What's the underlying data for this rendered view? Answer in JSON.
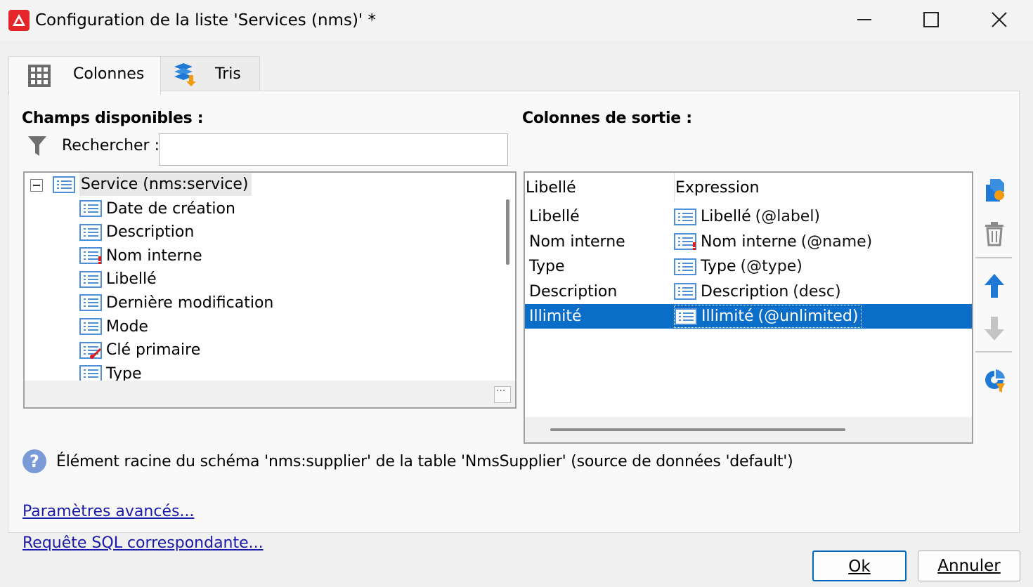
{
  "window": {
    "title": "Configuration de la liste 'Services (nms)' *"
  },
  "tabs": [
    {
      "label": "Colonnes",
      "icon": "grid-icon",
      "active": true
    },
    {
      "label": "Tris",
      "icon": "sort-icon",
      "active": false
    }
  ],
  "left_panel": {
    "title": "Champs disponibles :",
    "search_label": "Rechercher :",
    "search_value": "",
    "tree": {
      "root": "Service (nms:service)",
      "children": [
        {
          "label": "Date de création",
          "icon": "field-icon"
        },
        {
          "label": "Description",
          "icon": "field-icon"
        },
        {
          "label": "Nom interne",
          "icon": "field-required-icon"
        },
        {
          "label": "Libellé",
          "icon": "field-icon"
        },
        {
          "label": "Dernière modification",
          "icon": "field-icon"
        },
        {
          "label": "Mode",
          "icon": "field-icon"
        },
        {
          "label": "Clé primaire",
          "icon": "field-key-icon"
        },
        {
          "label": "Type",
          "icon": "field-icon"
        }
      ]
    }
  },
  "right_panel": {
    "title": "Colonnes de sortie :",
    "headers": {
      "label": "Libellé",
      "expression": "Expression"
    },
    "rows": [
      {
        "label": "Libellé",
        "expr_name": "Libellé",
        "expr_path": "(@label)",
        "icon": "field-icon",
        "selected": false
      },
      {
        "label": "Nom interne",
        "expr_name": "Nom interne",
        "expr_path": "(@name)",
        "icon": "field-required-icon",
        "selected": false
      },
      {
        "label": "Type",
        "expr_name": "Type",
        "expr_path": "(@type)",
        "icon": "field-icon",
        "selected": false
      },
      {
        "label": "Description",
        "expr_name": "Description",
        "expr_path": "(desc)",
        "icon": "field-icon",
        "selected": false
      },
      {
        "label": "Illimité",
        "expr_name": "Illimité",
        "expr_path": "(@unlimited)",
        "icon": "field-icon",
        "selected": true
      }
    ]
  },
  "side_tools": [
    "add-column-icon",
    "delete-icon",
    "move-up-icon",
    "move-down-icon",
    "distribution-icon"
  ],
  "info": {
    "text": "Élément racine du schéma 'nms:supplier' de la table 'NmsSupplier' (source de données 'default')"
  },
  "links": {
    "advanced": "Paramètres avancés...",
    "sql": "Requête SQL correspondante..."
  },
  "buttons": {
    "ok": "Ok",
    "cancel": "Annuler"
  },
  "colors": {
    "selection": "#0a6dc8",
    "app_icon": "#e4252a",
    "link": "#1a1aa8",
    "accent_blue": "#1e78d6",
    "accent_orange": "#f39c12"
  }
}
